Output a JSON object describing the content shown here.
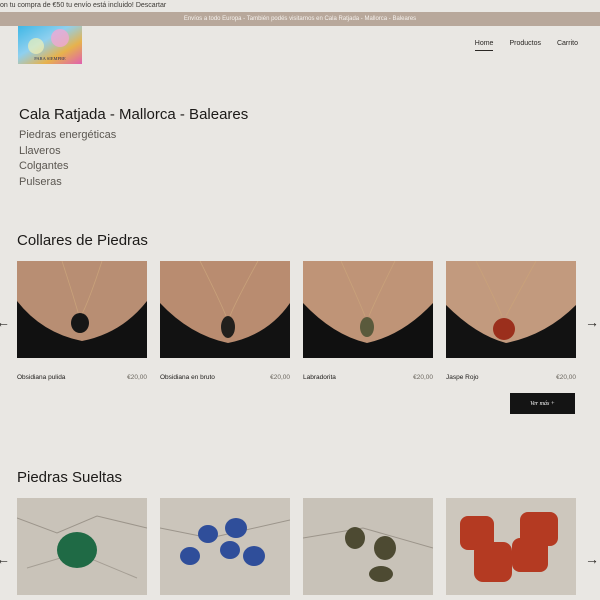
{
  "notice": {
    "text": "on tu compra de €50 tu envío está incluido!",
    "dismiss": "Descartar"
  },
  "ship_bar": {
    "text": "Envíos a todo Europa - También podés visitarnos en Cala Ratjada - Mallorca - Baleares"
  },
  "brand": {
    "logo_text": "PARA SIEMPRE"
  },
  "nav": {
    "items": [
      "Home",
      "Productos",
      "Carrito"
    ],
    "active": "Home"
  },
  "hero": {
    "title": "Cala Ratjada - Mallorca - Baleares",
    "links": [
      "Piedras energéticas",
      "Llaveros",
      "Colgantes",
      "Pulseras"
    ]
  },
  "collares": {
    "title": "Collares de Piedras",
    "button": "Ver más  +",
    "products": [
      {
        "name": "Obsidiana pulida",
        "price": "€20,00",
        "stone_color": "#161616"
      },
      {
        "name": "Obsidiana en bruto",
        "price": "€20,00",
        "stone_color": "#22201d"
      },
      {
        "name": "Labradorita",
        "price": "€20,00",
        "stone_color": "#5a5a3c"
      },
      {
        "name": "Jaspe Rojo",
        "price": "€20,00",
        "stone_color": "#9b2f1c"
      }
    ]
  },
  "sueltas": {
    "title": "Piedras Sueltas",
    "products": [
      {
        "stone_color": "#1f6a45"
      },
      {
        "stone_color": "#2f4e9a"
      },
      {
        "stone_color": "#4d4a32"
      },
      {
        "stone_color": "#b43a22"
      }
    ]
  },
  "icons": {
    "prev": "arrow-left-icon",
    "next": "arrow-right-icon"
  }
}
